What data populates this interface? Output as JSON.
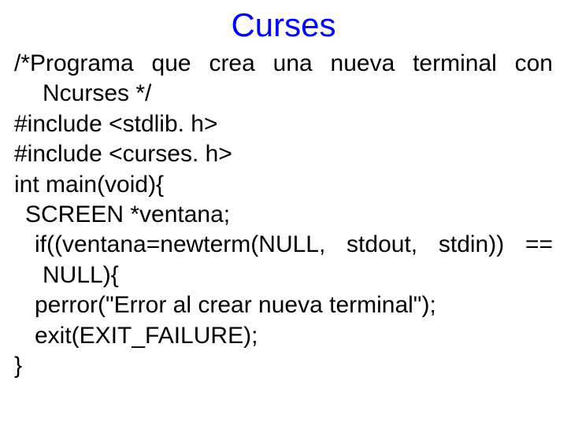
{
  "title": "Curses",
  "code": {
    "comment1": "/*Programa que crea una nueva terminal con",
    "comment2": "Ncurses */",
    "include1": "#include <stdlib. h>",
    "include2": "#include <curses. h>",
    "main": "int main(void){",
    "screen": "SCREEN *ventana;",
    "if_line": "if((ventana=newterm(NULL, stdout, stdin)) ==",
    "null_line": "NULL){",
    "perror": "perror(\"Error al crear nueva terminal\");",
    "exit": "exit(EXIT_FAILURE);",
    "close": "}"
  }
}
